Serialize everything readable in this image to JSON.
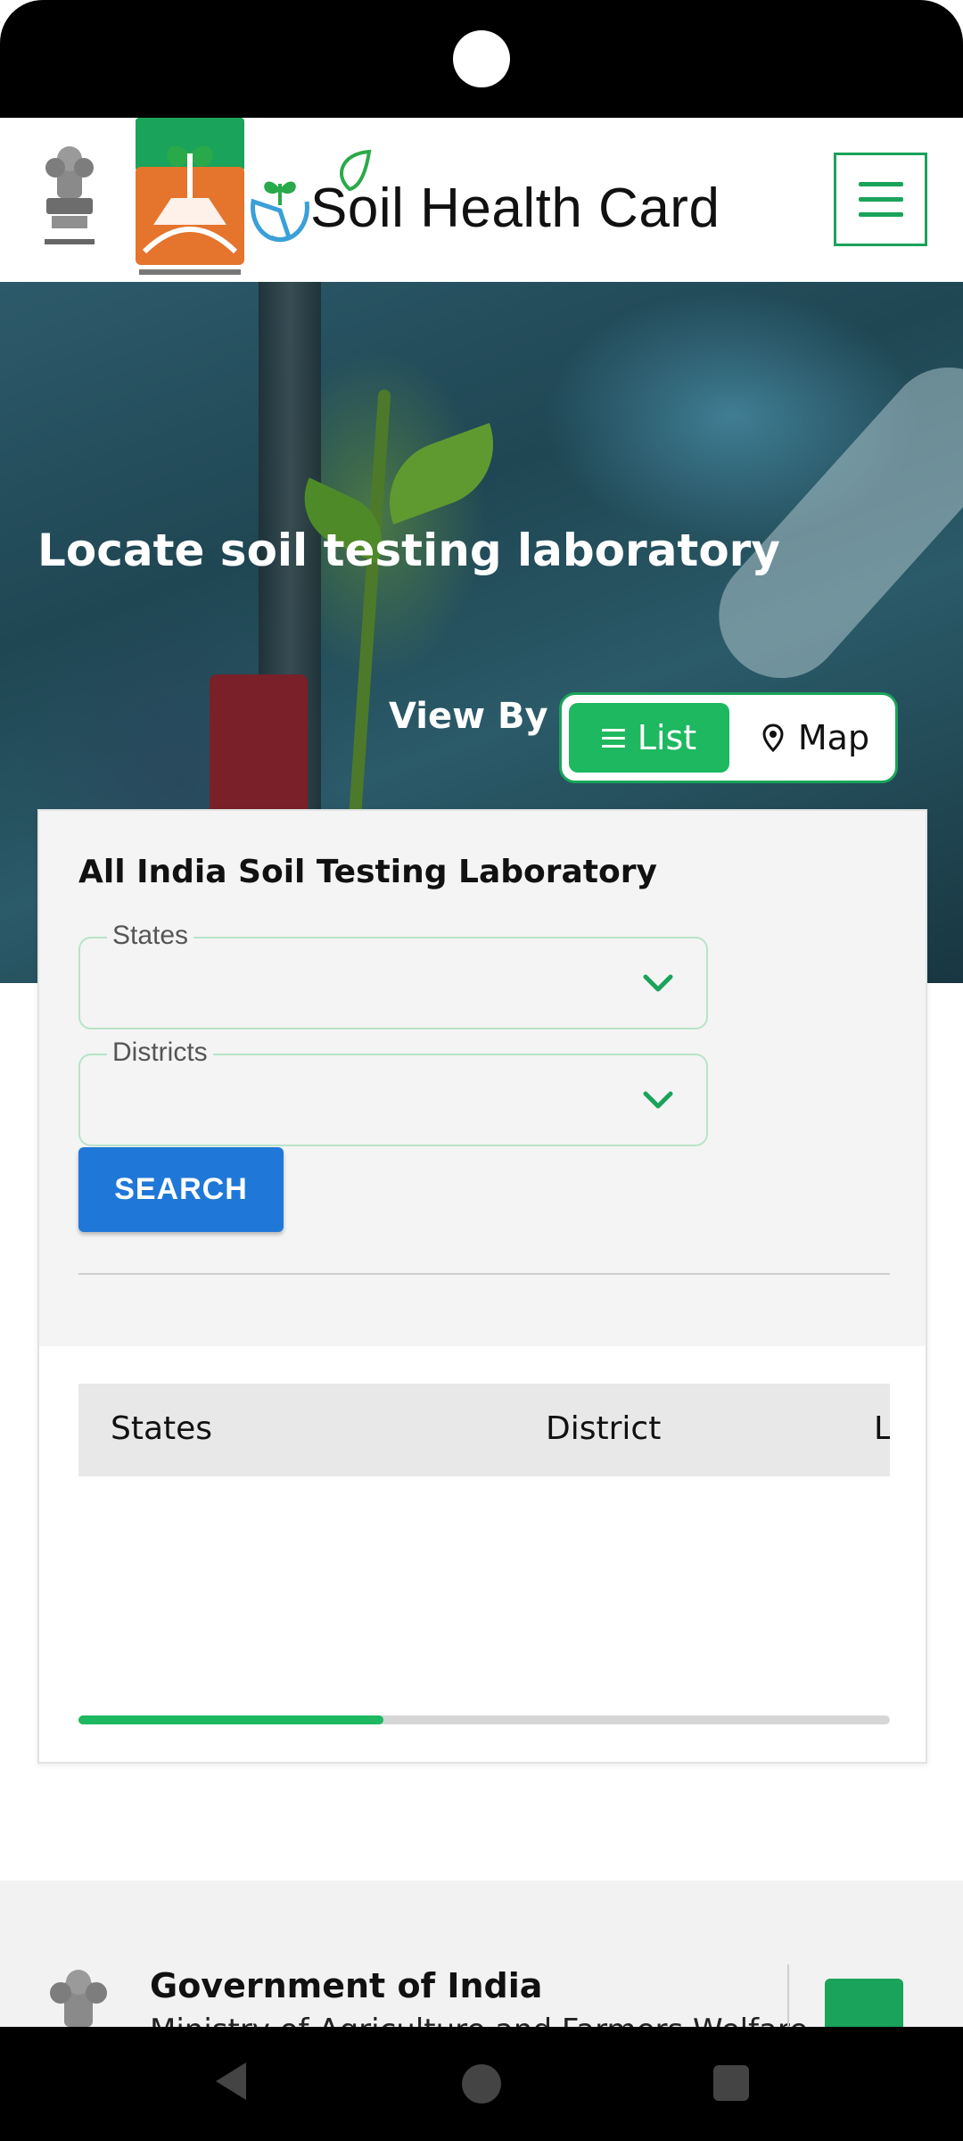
{
  "header": {
    "brand_title": "Soil Health Card",
    "menu_icon": "hamburger-menu-icon"
  },
  "hero": {
    "title": "Locate soil testing laboratory",
    "view_by_label": "View By",
    "toggle": {
      "list_label": "List",
      "map_label": "Map",
      "selected": "List"
    }
  },
  "search_panel": {
    "title": "All India Soil Testing Laboratory",
    "states_field": {
      "label": "States",
      "value": ""
    },
    "districts_field": {
      "label": "Districts",
      "value": ""
    },
    "search_label": "SEARCH"
  },
  "table": {
    "columns": [
      "States",
      "District",
      "L"
    ],
    "rows": [],
    "scroll_progress": 0.376
  },
  "footer": {
    "gov_title": "Government of India",
    "ministry": "Ministry of Agriculture and Farmers Welfare"
  },
  "colors": {
    "brand_green": "#1aa35a",
    "toggle_green": "#1db860",
    "search_blue": "#1f78d8"
  }
}
